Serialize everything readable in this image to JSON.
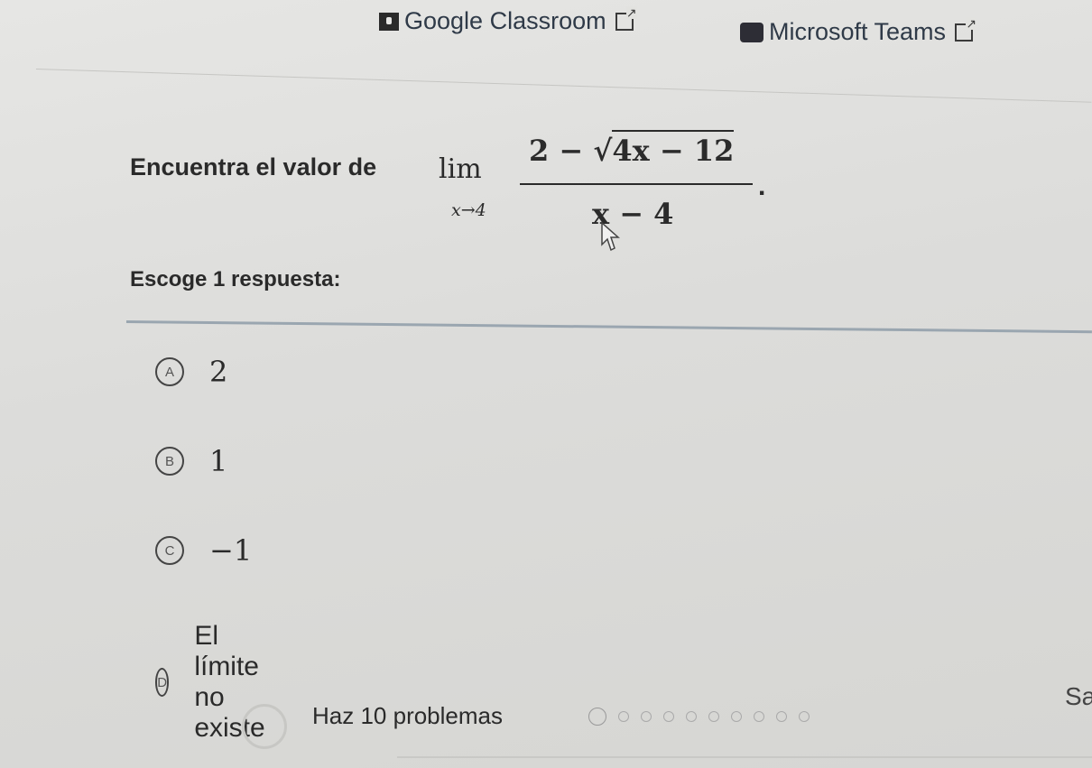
{
  "header": {
    "links": [
      {
        "label": "Google Classroom",
        "icon": "google-classroom-icon"
      },
      {
        "label": "Microsoft Teams",
        "icon": "microsoft-teams-icon"
      }
    ]
  },
  "question": {
    "prompt": "Encuentra el valor de",
    "lim_word": "lim",
    "lim_sub": "x→4",
    "numerator_prefix": "2 − ",
    "radical_symbol": "√",
    "radicand": "4x − 12",
    "denominator": "x − 4",
    "period": "."
  },
  "instructions": "Escoge 1 respuesta:",
  "options": [
    {
      "letter": "A",
      "text": "2"
    },
    {
      "letter": "B",
      "text": "1"
    },
    {
      "letter": "C",
      "text": "−1"
    },
    {
      "letter": "D",
      "text": "El límite no existe"
    }
  ],
  "footer": {
    "task_label": "Haz 10 problemas",
    "progress": {
      "total": 10,
      "completed": 0
    },
    "skip_label_partial": "Sa"
  },
  "colors": {
    "background": "#dcdcda",
    "text": "#2a2a2a",
    "divider": "#9aa6b0"
  }
}
